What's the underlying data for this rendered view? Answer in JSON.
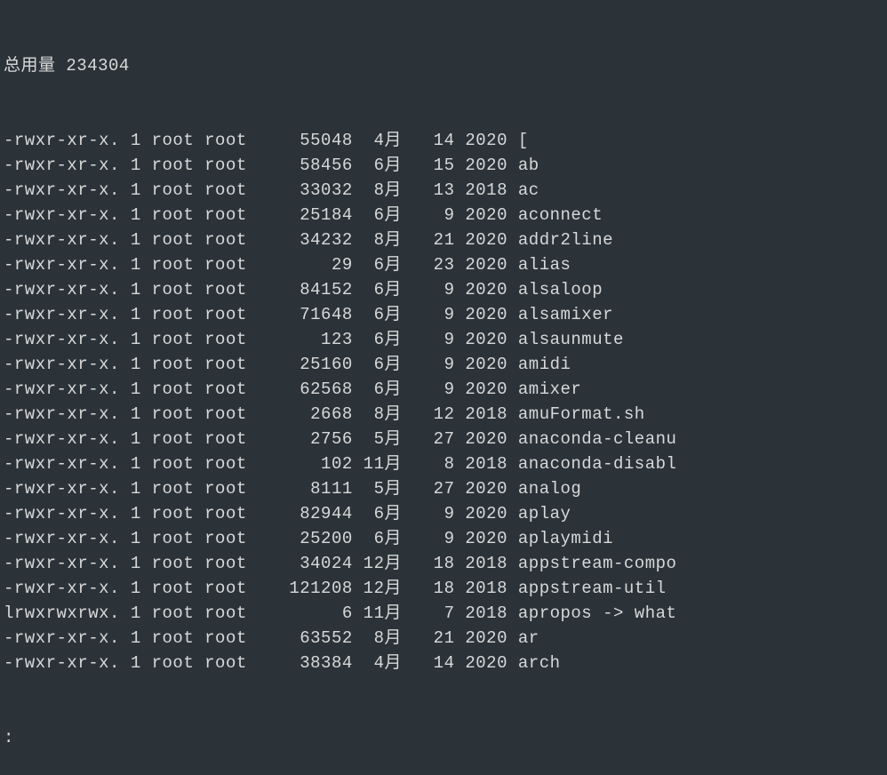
{
  "header": "总用量 234304",
  "prompt": ":",
  "rows": [
    {
      "perm": "-rwxr-xr-x.",
      "links": "1",
      "owner": "root",
      "group": "root",
      "size": "55048",
      "month": "4月",
      "day": "14",
      "year": "2020",
      "name": "["
    },
    {
      "perm": "-rwxr-xr-x.",
      "links": "1",
      "owner": "root",
      "group": "root",
      "size": "58456",
      "month": "6月",
      "day": "15",
      "year": "2020",
      "name": "ab"
    },
    {
      "perm": "-rwxr-xr-x.",
      "links": "1",
      "owner": "root",
      "group": "root",
      "size": "33032",
      "month": "8月",
      "day": "13",
      "year": "2018",
      "name": "ac"
    },
    {
      "perm": "-rwxr-xr-x.",
      "links": "1",
      "owner": "root",
      "group": "root",
      "size": "25184",
      "month": "6月",
      "day": "9",
      "year": "2020",
      "name": "aconnect"
    },
    {
      "perm": "-rwxr-xr-x.",
      "links": "1",
      "owner": "root",
      "group": "root",
      "size": "34232",
      "month": "8月",
      "day": "21",
      "year": "2020",
      "name": "addr2line"
    },
    {
      "perm": "-rwxr-xr-x.",
      "links": "1",
      "owner": "root",
      "group": "root",
      "size": "29",
      "month": "6月",
      "day": "23",
      "year": "2020",
      "name": "alias"
    },
    {
      "perm": "-rwxr-xr-x.",
      "links": "1",
      "owner": "root",
      "group": "root",
      "size": "84152",
      "month": "6月",
      "day": "9",
      "year": "2020",
      "name": "alsaloop"
    },
    {
      "perm": "-rwxr-xr-x.",
      "links": "1",
      "owner": "root",
      "group": "root",
      "size": "71648",
      "month": "6月",
      "day": "9",
      "year": "2020",
      "name": "alsamixer"
    },
    {
      "perm": "-rwxr-xr-x.",
      "links": "1",
      "owner": "root",
      "group": "root",
      "size": "123",
      "month": "6月",
      "day": "9",
      "year": "2020",
      "name": "alsaunmute"
    },
    {
      "perm": "-rwxr-xr-x.",
      "links": "1",
      "owner": "root",
      "group": "root",
      "size": "25160",
      "month": "6月",
      "day": "9",
      "year": "2020",
      "name": "amidi"
    },
    {
      "perm": "-rwxr-xr-x.",
      "links": "1",
      "owner": "root",
      "group": "root",
      "size": "62568",
      "month": "6月",
      "day": "9",
      "year": "2020",
      "name": "amixer"
    },
    {
      "perm": "-rwxr-xr-x.",
      "links": "1",
      "owner": "root",
      "group": "root",
      "size": "2668",
      "month": "8月",
      "day": "12",
      "year": "2018",
      "name": "amuFormat.sh"
    },
    {
      "perm": "-rwxr-xr-x.",
      "links": "1",
      "owner": "root",
      "group": "root",
      "size": "2756",
      "month": "5月",
      "day": "27",
      "year": "2020",
      "name": "anaconda-cleanu"
    },
    {
      "perm": "-rwxr-xr-x.",
      "links": "1",
      "owner": "root",
      "group": "root",
      "size": "102",
      "month": "11月",
      "day": "8",
      "year": "2018",
      "name": "anaconda-disabl"
    },
    {
      "perm": "-rwxr-xr-x.",
      "links": "1",
      "owner": "root",
      "group": "root",
      "size": "8111",
      "month": "5月",
      "day": "27",
      "year": "2020",
      "name": "analog"
    },
    {
      "perm": "-rwxr-xr-x.",
      "links": "1",
      "owner": "root",
      "group": "root",
      "size": "82944",
      "month": "6月",
      "day": "9",
      "year": "2020",
      "name": "aplay"
    },
    {
      "perm": "-rwxr-xr-x.",
      "links": "1",
      "owner": "root",
      "group": "root",
      "size": "25200",
      "month": "6月",
      "day": "9",
      "year": "2020",
      "name": "aplaymidi"
    },
    {
      "perm": "-rwxr-xr-x.",
      "links": "1",
      "owner": "root",
      "group": "root",
      "size": "34024",
      "month": "12月",
      "day": "18",
      "year": "2018",
      "name": "appstream-compo"
    },
    {
      "perm": "-rwxr-xr-x.",
      "links": "1",
      "owner": "root",
      "group": "root",
      "size": "121208",
      "month": "12月",
      "day": "18",
      "year": "2018",
      "name": "appstream-util"
    },
    {
      "perm": "lrwxrwxrwx.",
      "links": "1",
      "owner": "root",
      "group": "root",
      "size": "6",
      "month": "11月",
      "day": "7",
      "year": "2018",
      "name": "apropos -> what"
    },
    {
      "perm": "-rwxr-xr-x.",
      "links": "1",
      "owner": "root",
      "group": "root",
      "size": "63552",
      "month": "8月",
      "day": "21",
      "year": "2020",
      "name": "ar"
    },
    {
      "perm": "-rwxr-xr-x.",
      "links": "1",
      "owner": "root",
      "group": "root",
      "size": "38384",
      "month": "4月",
      "day": "14",
      "year": "2020",
      "name": "arch"
    }
  ]
}
